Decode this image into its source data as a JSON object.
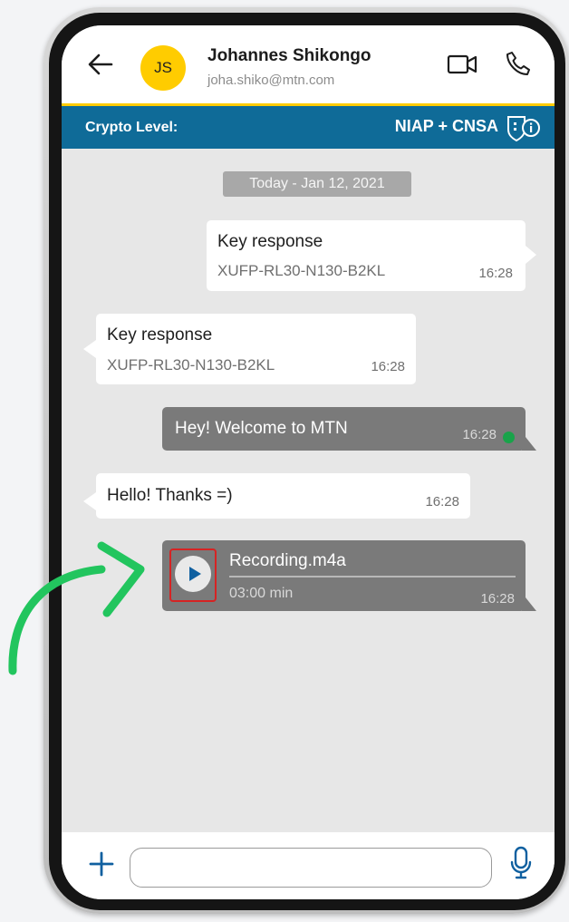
{
  "header": {
    "avatar_initials": "JS",
    "contact_name": "Johannes Shikongo",
    "contact_email": "joha.shiko@mtn.com",
    "icons": [
      "back-arrow-icon",
      "video-call-icon",
      "phone-call-icon"
    ]
  },
  "crypto": {
    "label": "Crypto Level:",
    "value": "NIAP + CNSA",
    "icon": "shield-info-icon"
  },
  "chat": {
    "date_separator": "Today - Jan 12, 2021",
    "messages": [
      {
        "direction": "outgoing",
        "style": "white",
        "title": "Key response",
        "subtitle": "XUFP-RL30-N130-B2KL",
        "time": "16:28"
      },
      {
        "direction": "incoming",
        "style": "white",
        "title": "Key response",
        "subtitle": "XUFP-RL30-N130-B2KL",
        "time": "16:28"
      },
      {
        "direction": "outgoing",
        "style": "grey",
        "text": "Hey! Welcome to MTN",
        "time": "16:28",
        "status": "delivered"
      },
      {
        "direction": "incoming",
        "style": "white",
        "text": "Hello! Thanks =)",
        "time": "16:28"
      },
      {
        "direction": "outgoing",
        "style": "grey",
        "type": "audio",
        "file_name": "Recording.m4a",
        "duration": "03:00 min",
        "time": "16:28",
        "progress": 0
      }
    ]
  },
  "composer": {
    "placeholder": "",
    "icons": [
      "plus-icon",
      "microphone-icon"
    ]
  },
  "colors": {
    "accent": "#ffcc00",
    "crypto_bar": "#0f6b98",
    "annotation_arrow": "#22c55e",
    "highlight_box": "#d62323"
  }
}
